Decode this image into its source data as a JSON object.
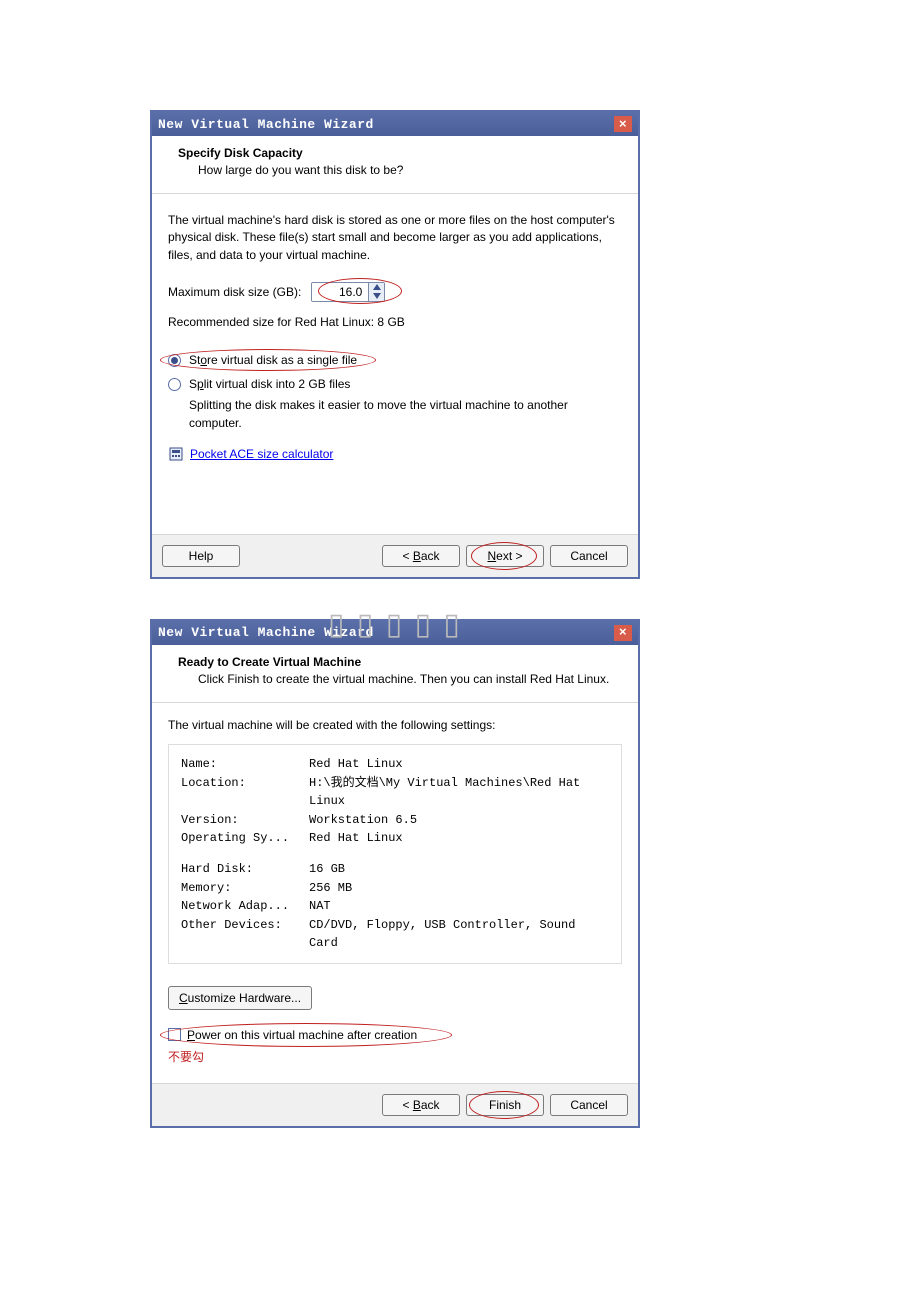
{
  "dialog1": {
    "title": "New Virtual Machine Wizard",
    "heading": "Specify Disk Capacity",
    "subheading": "How large do you want this disk to be?",
    "explain": "The virtual machine's hard disk is stored as one or more files on the host computer's physical disk. These file(s) start small and become larger as you add applications, files, and data to your virtual machine.",
    "max_label": "Maximum disk size (GB):",
    "max_value": "16.0",
    "recommended": "Recommended size for Red Hat Linux: 8 GB",
    "opt_single_prefix": "St",
    "opt_single_u": "o",
    "opt_single_suffix": "re virtual disk as a single file",
    "opt_split_prefix": "S",
    "opt_split_u": "p",
    "opt_split_suffix": "lit virtual disk into 2 GB files",
    "split_note": "Splitting the disk makes it easier to move the virtual machine to another computer.",
    "link": "Pocket ACE size calculator",
    "buttons": {
      "help": "Help",
      "back_u": "B",
      "back_s": "ack",
      "next_u": "N",
      "next_s": "ext >",
      "cancel": "Cancel"
    }
  },
  "dialog2": {
    "title": "New Virtual Machine Wizard",
    "heading": "Ready to Create Virtual Machine",
    "subheading": "Click Finish to create the virtual machine. Then you can install Red Hat Linux.",
    "created_with": "The virtual machine will be created with the following settings:",
    "settings": {
      "name_k": "Name:",
      "name_v": "Red Hat Linux",
      "loc_k": "Location:",
      "loc_v": "H:\\我的文档\\My Virtual Machines\\Red Hat Linux",
      "ver_k": "Version:",
      "ver_v": "Workstation 6.5",
      "os_k": "Operating Sy...",
      "os_v": "Red Hat Linux",
      "hd_k": "Hard Disk:",
      "hd_v": "16 GB",
      "mem_k": "Memory:",
      "mem_v": "256 MB",
      "net_k": "Network Adap...",
      "net_v": "NAT",
      "oth_k": "Other Devices:",
      "oth_v": "CD/DVD, Floppy, USB Controller, Sound Card"
    },
    "custom_u": "C",
    "custom_s": "ustomize Hardware...",
    "power_u": "P",
    "power_s": "ower on this virtual machine after creation",
    "annotation": "不要勾",
    "buttons": {
      "back_u": "B",
      "back_s": "ack",
      "finish": "Finish",
      "cancel": "Cancel"
    }
  }
}
